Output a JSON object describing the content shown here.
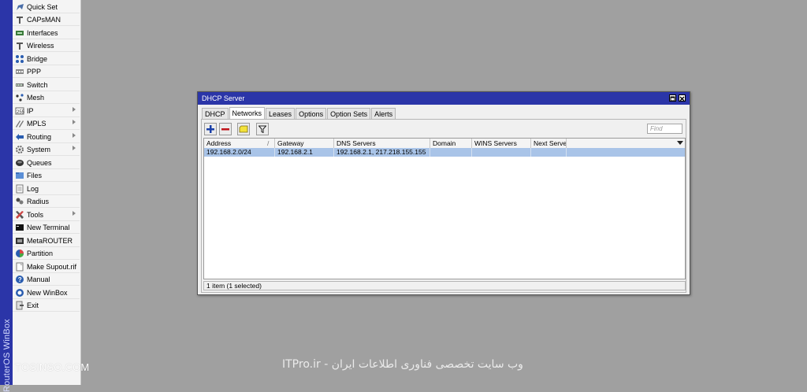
{
  "app": {
    "brand": "RouterOS WinBox",
    "sidebar": {
      "items": [
        {
          "label": "Quick Set",
          "icon": "quick-set-icon",
          "submenu": false
        },
        {
          "label": "CAPsMAN",
          "icon": "capsman-icon",
          "submenu": false
        },
        {
          "label": "Interfaces",
          "icon": "interfaces-icon",
          "submenu": false
        },
        {
          "label": "Wireless",
          "icon": "wireless-icon",
          "submenu": false
        },
        {
          "label": "Bridge",
          "icon": "bridge-icon",
          "submenu": false
        },
        {
          "label": "PPP",
          "icon": "ppp-icon",
          "submenu": false
        },
        {
          "label": "Switch",
          "icon": "switch-icon",
          "submenu": false
        },
        {
          "label": "Mesh",
          "icon": "mesh-icon",
          "submenu": false
        },
        {
          "label": "IP",
          "icon": "ip-icon",
          "submenu": true
        },
        {
          "label": "MPLS",
          "icon": "mpls-icon",
          "submenu": true
        },
        {
          "label": "Routing",
          "icon": "routing-icon",
          "submenu": true
        },
        {
          "label": "System",
          "icon": "system-icon",
          "submenu": true
        },
        {
          "label": "Queues",
          "icon": "queues-icon",
          "submenu": false
        },
        {
          "label": "Files",
          "icon": "files-icon",
          "submenu": false
        },
        {
          "label": "Log",
          "icon": "log-icon",
          "submenu": false
        },
        {
          "label": "Radius",
          "icon": "radius-icon",
          "submenu": false
        },
        {
          "label": "Tools",
          "icon": "tools-icon",
          "submenu": true
        },
        {
          "label": "New Terminal",
          "icon": "terminal-icon",
          "submenu": false
        },
        {
          "label": "MetaROUTER",
          "icon": "metarouter-icon",
          "submenu": false
        },
        {
          "label": "Partition",
          "icon": "partition-icon",
          "submenu": false
        },
        {
          "label": "Make Supout.rif",
          "icon": "supout-icon",
          "submenu": false
        },
        {
          "label": "Manual",
          "icon": "manual-icon",
          "submenu": false
        },
        {
          "label": "New WinBox",
          "icon": "winbox-icon",
          "submenu": false
        },
        {
          "label": "Exit",
          "icon": "exit-icon",
          "submenu": false
        }
      ]
    }
  },
  "dhcp_window": {
    "title": "DHCP Server",
    "tabs": [
      "DHCP",
      "Networks",
      "Leases",
      "Options",
      "Option Sets",
      "Alerts"
    ],
    "active_tab": "Networks",
    "find_placeholder": "Find",
    "columns": [
      "Address",
      "Gateway",
      "DNS Servers",
      "Domain",
      "WINS Servers",
      "Next Server"
    ],
    "sort_indicator": "/",
    "rows": [
      {
        "address": "192.168.2.0/24",
        "gateway": "192.168.2.1",
        "dns": "192.168.2.1, 217.218.155.155",
        "domain": "",
        "wins": "",
        "next_server": ""
      }
    ],
    "status": "1 item (1 selected)"
  },
  "watermarks": {
    "left": "TOSINSO.COM",
    "center": "ITPro.ir - وب سایت تخصصی فناوری اطلاعات ایران"
  },
  "colors": {
    "accent": "#2b35a8",
    "desktop": "#a0a0a0",
    "selection": "#a9c4e8"
  }
}
